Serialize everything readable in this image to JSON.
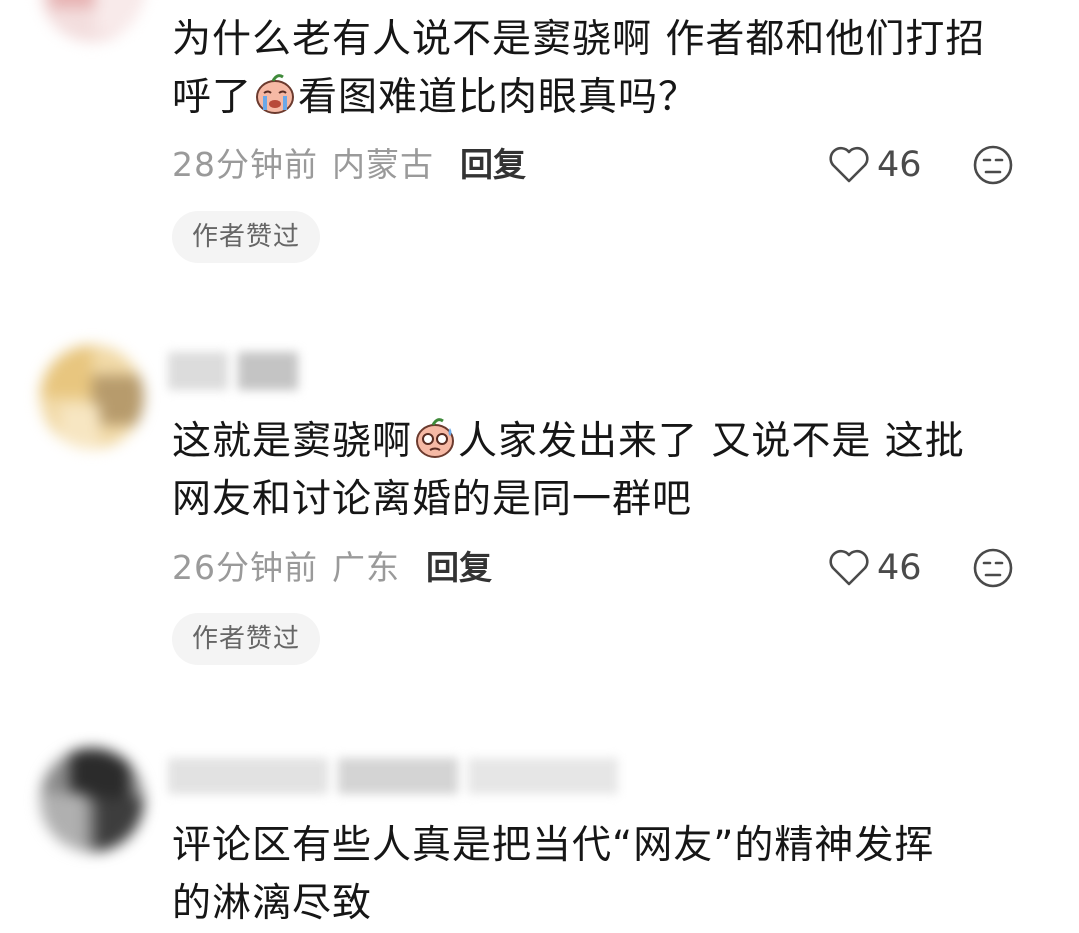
{
  "comments": [
    {
      "text_lines": [
        [
          "为什么老有人说不是窦骁啊 作者都和他们打招"
        ],
        [
          "呼了",
          "{emoji:crying-face}",
          "看图难道比肉眼真吗？"
        ]
      ],
      "time": "28分钟前",
      "location": "内蒙古",
      "reply_label": "回复",
      "likes": "46",
      "badge": "作者赞过"
    },
    {
      "text_lines": [
        [
          "这就是窦骁啊",
          "{emoji:nervous-face}",
          "人家发出来了 又说不是 这批"
        ],
        [
          "网友和讨论离婚的是同一群吧"
        ]
      ],
      "time": "26分钟前",
      "location": "广东",
      "reply_label": "回复",
      "likes": "46",
      "badge": "作者赞过"
    },
    {
      "text_lines": [
        [
          "评论区有些人真是把当代“网友”的精神发挥"
        ],
        [
          "的淋漓尽致"
        ]
      ]
    }
  ],
  "colors": {
    "text": "#161616",
    "meta": "#9a9a9a",
    "reply": "#333333",
    "badge_bg": "#f4f4f4",
    "badge_text": "#666666",
    "icon": "#4a4a4a"
  },
  "icons": {
    "like": "heart-outline-icon",
    "dislike": "meh-face-icon",
    "emoji_1": "crying-face-emoji",
    "emoji_2": "nervous-face-emoji"
  }
}
